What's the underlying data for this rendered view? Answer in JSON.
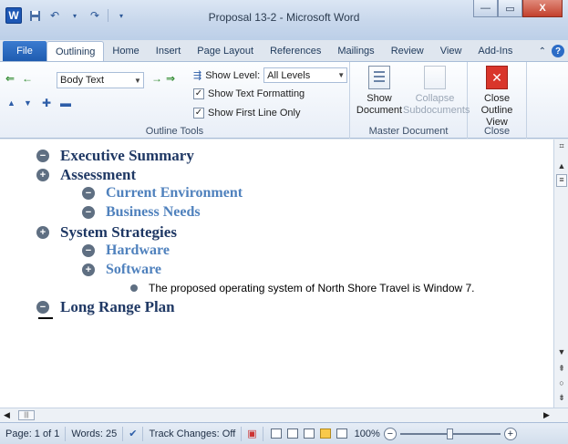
{
  "titlebar": {
    "title": "Proposal 13-2  -  Microsoft Word",
    "logo": "W",
    "icons": [
      "word-logo-icon",
      "save-icon",
      "undo-icon",
      "redo-icon",
      "customize-icon"
    ]
  },
  "window_buttons": {
    "minimize": "—",
    "maximize": "▭",
    "close": "X"
  },
  "tabs": [
    {
      "label": "File"
    },
    {
      "label": "Outlining"
    },
    {
      "label": "Home"
    },
    {
      "label": "Insert"
    },
    {
      "label": "Page Layout"
    },
    {
      "label": "References"
    },
    {
      "label": "Mailings"
    },
    {
      "label": "Review"
    },
    {
      "label": "View"
    },
    {
      "label": "Add-Ins"
    }
  ],
  "ribbon": {
    "outline_tools": {
      "label": "Outline Tools",
      "level_combo": "Body Text",
      "show_level_label": "Show Level:",
      "show_level_value": "All Levels",
      "show_text_formatting": "Show Text Formatting",
      "show_first_line_only": "Show First Line Only"
    },
    "master_document": {
      "label": "Master Document",
      "show_document": [
        "Show",
        "Document"
      ],
      "collapse_subdocuments": [
        "Collapse",
        "Subdocuments"
      ]
    },
    "close": {
      "label": "Close",
      "close_outline_view": [
        "Close",
        "Outline View"
      ]
    }
  },
  "outline": [
    {
      "level": 1,
      "symbol": "minus",
      "text": "Executive Summary"
    },
    {
      "level": 1,
      "symbol": "plus",
      "text": "Assessment"
    },
    {
      "level": 2,
      "symbol": "minus",
      "text": "Current Environment"
    },
    {
      "level": 2,
      "symbol": "minus",
      "text": "Business Needs"
    },
    {
      "level": 1,
      "symbol": "plus",
      "text": "System Strategies"
    },
    {
      "level": 2,
      "symbol": "minus",
      "text": "Hardware"
    },
    {
      "level": 2,
      "symbol": "plus",
      "text": "Software"
    },
    {
      "level": 3,
      "symbol": "body",
      "text": "The proposed operating system of North Shore Travel is Window 7."
    },
    {
      "level": 1,
      "symbol": "minus",
      "text": "Long Range Plan"
    }
  ],
  "status": {
    "page": "Page: 1 of 1",
    "words": "Words: 25",
    "track_changes": "Track Changes: Off",
    "zoom": "100%",
    "zoom_value": 100
  }
}
